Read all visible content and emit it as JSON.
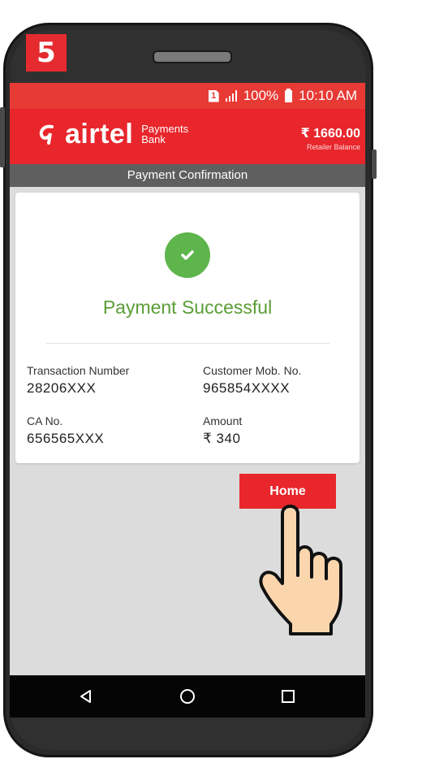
{
  "step_badge": "5",
  "status_bar": {
    "sim": "1",
    "battery": "100%",
    "time": "10:10 AM"
  },
  "header": {
    "brand": "airtel",
    "brand_sub_line1": "Payments",
    "brand_sub_line2": "Bank",
    "balance_amount": "₹ 1660.00",
    "balance_label": "Retailer Balance"
  },
  "page_title": "Payment Confirmation",
  "confirmation": {
    "status_text": "Payment Successful",
    "fields": [
      {
        "label": "Transaction Number",
        "value": "28206XXX"
      },
      {
        "label": "Customer Mob. No.",
        "value": "965854XXXX"
      },
      {
        "label": "CA No.",
        "value": "656565XXX"
      },
      {
        "label": "Amount",
        "value": "₹ 340"
      }
    ]
  },
  "home_button_label": "Home",
  "colors": {
    "brand_red": "#e8262c",
    "success_green": "#5db54b",
    "title_bar_gray": "#5f5f5f"
  },
  "icons": [
    "check-icon",
    "back-icon",
    "home-nav-icon",
    "recents-icon",
    "signal-icon",
    "battery-icon",
    "sim-icon"
  ]
}
